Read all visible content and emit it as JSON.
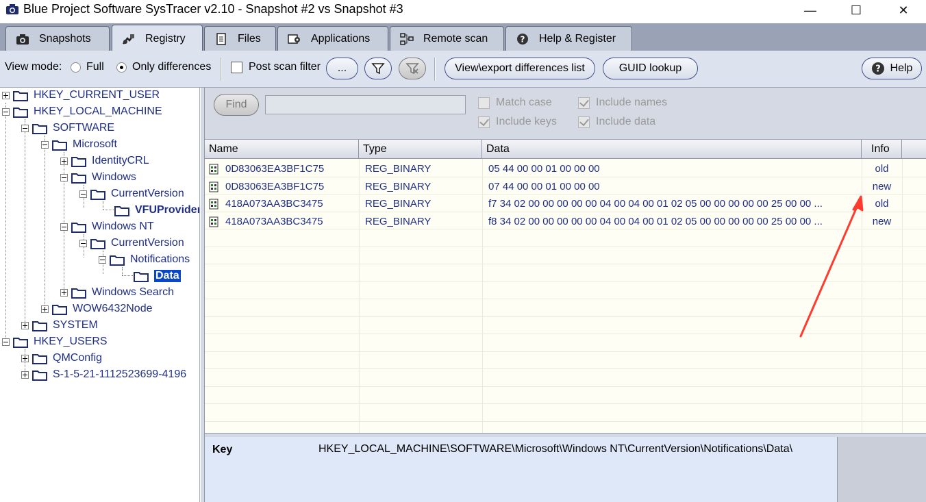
{
  "window": {
    "title": "Blue Project Software SysTracer v2.10 - Snapshot #2 vs Snapshot #3",
    "minimize_glyph": "—",
    "maximize_glyph": "☐",
    "close_glyph": "✕"
  },
  "tabs": [
    {
      "label": "Snapshots",
      "icon": "camera-icon",
      "active": false
    },
    {
      "label": "Registry",
      "icon": "registry-icon",
      "active": true
    },
    {
      "label": "Files",
      "icon": "files-icon",
      "active": false
    },
    {
      "label": "Applications",
      "icon": "applications-icon",
      "active": false
    },
    {
      "label": "Remote scan",
      "icon": "network-icon",
      "active": false
    },
    {
      "label": "Help & Register",
      "icon": "help-icon",
      "active": false
    }
  ],
  "toolbar": {
    "view_mode_label": "View mode:",
    "full_label": "Full",
    "only_diff_label": "Only differences",
    "view_mode_selected": "Only differences",
    "post_scan_label": "Post scan filter",
    "post_scan_checked": false,
    "ellipsis_label": "...",
    "export_label": "View\\export differences list",
    "guid_label": "GUID lookup",
    "help_label": "Help"
  },
  "tree": {
    "nodes": [
      {
        "label": "HKEY_CURRENT_USER",
        "expander": "plus"
      },
      {
        "label": "HKEY_LOCAL_MACHINE",
        "expander": "minus"
      },
      {
        "label": "SOFTWARE",
        "expander": "minus"
      },
      {
        "label": "Microsoft",
        "expander": "minus"
      },
      {
        "label": "IdentityCRL",
        "expander": "plus"
      },
      {
        "label": "Windows",
        "expander": "minus"
      },
      {
        "label": "CurrentVersion",
        "expander": "minus"
      },
      {
        "label": "VFUProvider",
        "expander": "none"
      },
      {
        "label": "Windows NT",
        "expander": "minus"
      },
      {
        "label": "CurrentVersion",
        "expander": "minus"
      },
      {
        "label": "Notifications",
        "expander": "minus"
      },
      {
        "label": "Data",
        "expander": "none",
        "selected": true
      },
      {
        "label": "Windows Search",
        "expander": "plus"
      },
      {
        "label": "WOW6432Node",
        "expander": "plus"
      },
      {
        "label": "SYSTEM",
        "expander": "plus"
      },
      {
        "label": "HKEY_USERS",
        "expander": "minus"
      },
      {
        "label": "QMConfig",
        "expander": "plus"
      },
      {
        "label": "S-1-5-21-1112523699-4196",
        "expander": "plus"
      }
    ]
  },
  "find": {
    "button_label": "Find",
    "input_value": "",
    "match_case_label": "Match case",
    "match_case_checked": false,
    "include_names_label": "Include names",
    "include_names_checked": true,
    "include_keys_label": "Include keys",
    "include_keys_checked": true,
    "include_data_label": "Include data",
    "include_data_checked": true
  },
  "list": {
    "columns": [
      "Name",
      "Type",
      "Data",
      "Info"
    ],
    "rows": [
      {
        "name": "0D83063EA3BF1C75",
        "type": "REG_BINARY",
        "data": "05 44 00 00 01 00 00 00",
        "info": "old"
      },
      {
        "name": "0D83063EA3BF1C75",
        "type": "REG_BINARY",
        "data": "07 44 00 00 01 00 00 00",
        "info": "new"
      },
      {
        "name": "418A073AA3BC3475",
        "type": "REG_BINARY",
        "data": "f7 34 02 00 00 00 00 00 04 00 04 00 01 02 05 00 00 00 00 00 25 00 00 ...",
        "info": "old"
      },
      {
        "name": "418A073AA3BC3475",
        "type": "REG_BINARY",
        "data": "f8 34 02 00 00 00 00 00 04 00 04 00 01 02 05 00 00 00 00 00 25 00 00 ...",
        "info": "new"
      }
    ]
  },
  "key_panel": {
    "label": "Key",
    "value": "HKEY_LOCAL_MACHINE\\SOFTWARE\\Microsoft\\Windows NT\\CurrentVersion\\Notifications\\Data\\"
  },
  "colors": {
    "tree_text": "#1f2f86",
    "selected_bg": "#0a46c8",
    "annotation_arrow": "#ff3b30",
    "list_bg": "#fffef4"
  }
}
